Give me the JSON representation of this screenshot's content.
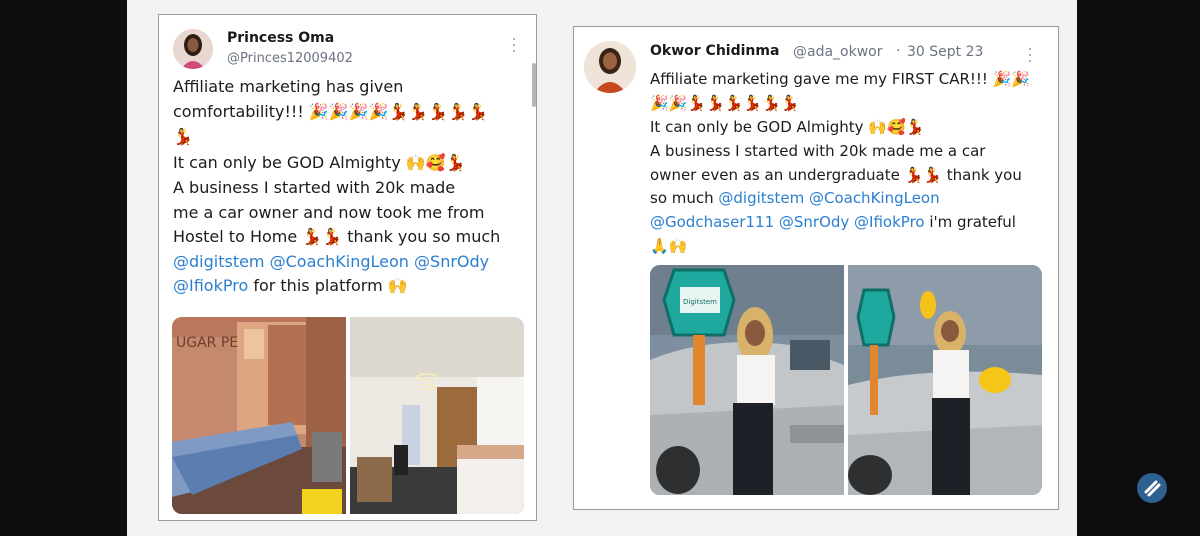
{
  "posts": [
    {
      "author_name": "Princess Oma",
      "author_handle": "@Princes12009402",
      "body_lines": [
        "Affiliate marketing has given",
        "comfortability!!! 🎉🎉🎉🎉💃💃💃💃💃",
        "💃",
        "It can only be GOD Almighty 🙌🥰💃",
        "A business I started with 20k made",
        "me a car owner and now took me from",
        "Hostel to Home 💃💃 thank you so much"
      ],
      "mentions_line1": "@digitstem @CoachKingLeon @SnrOdy",
      "mentions_line2": "@IfiokPro",
      "mentions_line2_suffix": " for this platform 🙌",
      "image1_wall_text": "UGAR PE"
    },
    {
      "author_name": "Okwor Chidinma",
      "author_handle": "@ada_okwor",
      "separator": "·",
      "date": "30 Sept 23",
      "body_lines": [
        "Affiliate marketing gave me my FIRST CAR!!! 🎉🎉",
        "🎉🎉💃💃💃💃💃💃",
        "It can only be GOD Almighty 🙌🥰💃",
        "A business I started with 20k made me a car",
        "owner even as an undergraduate 💃💃 thank you"
      ],
      "mentions_prefix": "so much ",
      "mentions_line1": "@digitstem @CoachKingLeon",
      "mentions_line2": "@Godchaser111 @SnrOdy @IfiokPro",
      "mentions_line2_suffix": " i'm grateful",
      "emoji_line": "🙏🙌",
      "key_label": "Digitstem"
    }
  ],
  "overlay": {
    "icon": "slash-logo-icon"
  }
}
